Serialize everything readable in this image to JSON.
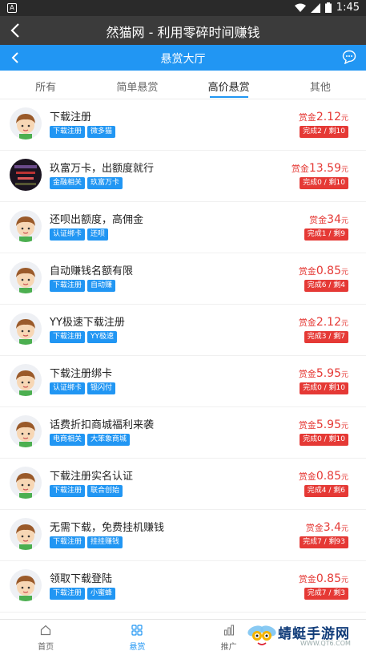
{
  "status_bar": {
    "time": "1:45"
  },
  "app_bar": {
    "title": "然猫网 - 利用零碎时间赚钱"
  },
  "header": {
    "title": "悬赏大厅"
  },
  "tabs": [
    {
      "label": "所有",
      "active": false
    },
    {
      "label": "简单悬赏",
      "active": false
    },
    {
      "label": "高价悬赏",
      "active": true
    },
    {
      "label": "其他",
      "active": false
    }
  ],
  "tasks": [
    {
      "title": "下载注册",
      "tags": [
        "下载注册",
        "微多猫"
      ],
      "reward_label": "赏金",
      "reward": "2.12",
      "unit": "元",
      "progress": "完成2 / 剩10",
      "avatar": "boy"
    },
    {
      "title": "玖富万卡，出额度就行",
      "tags": [
        "金融相关",
        "玖富万卡"
      ],
      "reward_label": "赏金",
      "reward": "13.59",
      "unit": "元",
      "progress": "完成0 / 剩10",
      "avatar": "dark"
    },
    {
      "title": "还呗出额度，高佣金",
      "tags": [
        "认证绑卡",
        "还呗"
      ],
      "reward_label": "赏金",
      "reward": "34",
      "unit": "元",
      "progress": "完成1 / 剩9",
      "avatar": "boy"
    },
    {
      "title": "自动赚钱名额有限",
      "tags": [
        "下载注册",
        "自动赚"
      ],
      "reward_label": "赏金",
      "reward": "0.85",
      "unit": "元",
      "progress": "完成6 / 剩4",
      "avatar": "boy"
    },
    {
      "title": "YY极速下载注册",
      "tags": [
        "下载注册",
        "YY极速"
      ],
      "reward_label": "赏金",
      "reward": "2.12",
      "unit": "元",
      "progress": "完成3 / 剩7",
      "avatar": "boy"
    },
    {
      "title": "下载注册绑卡",
      "tags": [
        "认证绑卡",
        "银闪付"
      ],
      "reward_label": "赏金",
      "reward": "5.95",
      "unit": "元",
      "progress": "完成0 / 剩10",
      "avatar": "boy"
    },
    {
      "title": "话费折扣商城福利来袭",
      "tags": [
        "电商相关",
        "大笨象商城"
      ],
      "reward_label": "赏金",
      "reward": "5.95",
      "unit": "元",
      "progress": "完成0 / 剩10",
      "avatar": "boy"
    },
    {
      "title": "下载注册实名认证",
      "tags": [
        "下载注册",
        "联合创始"
      ],
      "reward_label": "赏金",
      "reward": "0.85",
      "unit": "元",
      "progress": "完成4 / 剩6",
      "avatar": "boy"
    },
    {
      "title": "无需下载，免费挂机赚钱",
      "tags": [
        "下载注册",
        "挂挂赚钱"
      ],
      "reward_label": "赏金",
      "reward": "3.4",
      "unit": "元",
      "progress": "完成7 / 剩93",
      "avatar": "boy"
    },
    {
      "title": "领取下载登陆",
      "tags": [
        "下载注册",
        "小蜜蜂"
      ],
      "reward_label": "赏金",
      "reward": "0.85",
      "unit": "元",
      "progress": "完成7 / 剩3",
      "avatar": "boy"
    }
  ],
  "bottom_nav": [
    {
      "label": "首页",
      "icon": "home-icon",
      "active": false
    },
    {
      "label": "悬赏",
      "icon": "grid-icon",
      "active": true
    },
    {
      "label": "推广",
      "icon": "chart-icon",
      "active": false
    }
  ],
  "watermark": {
    "text": "蜻蜓手游网",
    "url": "WWW.QT6.COM"
  },
  "colors": {
    "primary": "#2196f3",
    "reward": "#e53935",
    "appbar": "#3b3b3b"
  }
}
